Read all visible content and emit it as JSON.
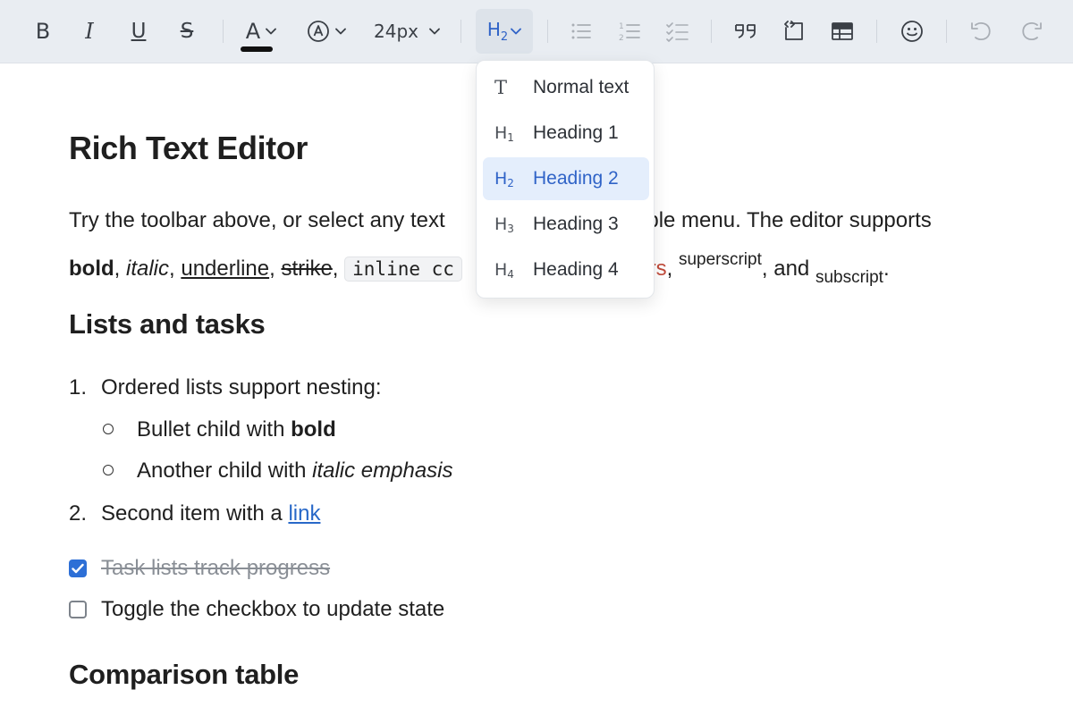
{
  "toolbar": {
    "bold": "B",
    "italic": "I",
    "underline": "U",
    "strike": "S",
    "text_color": "A",
    "font_size": "24px",
    "heading_selected": "H",
    "heading_selected_sub": "2",
    "text_color_swatch": "#111111"
  },
  "dropdown": {
    "items": [
      {
        "icon": "T",
        "sub": "",
        "label": "Normal text"
      },
      {
        "icon": "H",
        "sub": "1",
        "label": "Heading 1"
      },
      {
        "icon": "H",
        "sub": "2",
        "label": "Heading 2"
      },
      {
        "icon": "H",
        "sub": "3",
        "label": "Heading 3"
      },
      {
        "icon": "H",
        "sub": "4",
        "label": "Heading 4"
      }
    ],
    "selected_index": 2
  },
  "document": {
    "title": "Rich Text Editor",
    "intro_line1_a": "Try the toolbar above, or select any text",
    "intro_line1_b": "ubble menu. The editor supports",
    "intro_line2": {
      "bold": "bold",
      "italic": "italic",
      "underline": "underline",
      "strike": "strike",
      "code": "inline cc",
      "colors": "lors",
      "superscript": "superscript",
      "and": "and",
      "subscript": "subscript"
    },
    "lists_heading": "Lists and tasks",
    "ordered": [
      {
        "num": "1.",
        "text": "Ordered lists support nesting:"
      },
      {
        "num": "2.",
        "text": "Second item with a ",
        "link": "link"
      }
    ],
    "bullets": [
      {
        "text": "Bullet child with ",
        "strong": "bold"
      },
      {
        "text": "Another child with ",
        "em": "italic emphasis"
      }
    ],
    "tasks": [
      {
        "text": "Task lists track progress",
        "checked": true
      },
      {
        "text": "Toggle the checkbox to update state",
        "checked": false
      }
    ],
    "table_heading": "Comparison table"
  },
  "colors": {
    "accent": "#2f63c7",
    "link": "#2868c8",
    "text_red": "#c14b3b",
    "checkbox": "#2d6fd6",
    "toolbar_bg": "#e9edf2"
  }
}
